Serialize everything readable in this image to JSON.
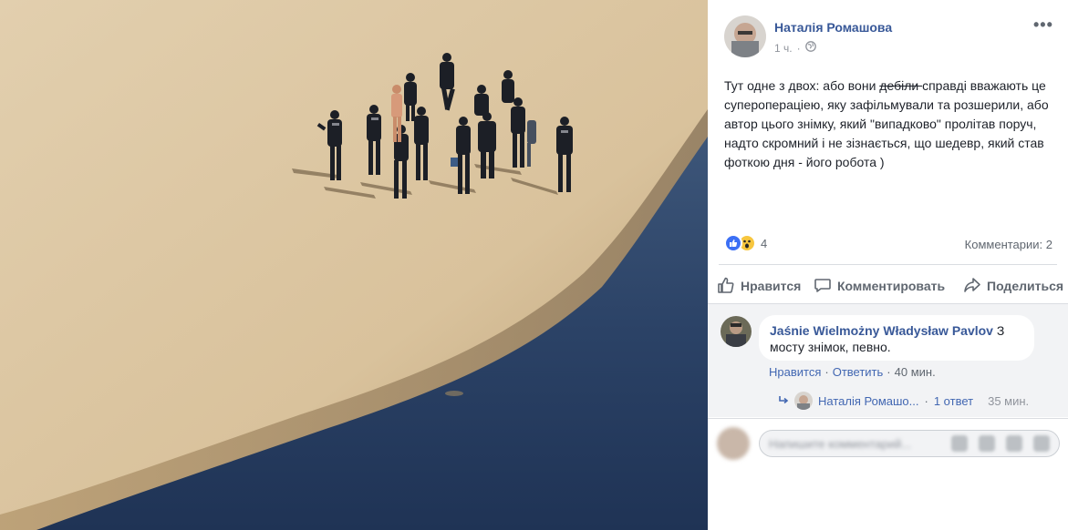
{
  "post": {
    "author": "Наталія Ромашова",
    "time": "1 ч.",
    "privacy_icon": "globe-icon",
    "more_icon": "more-icon",
    "more_label": "•••",
    "text_part1": "Тут одне з двох: або вони ",
    "text_struck": "дебіли ",
    "text_part2": "справді вважають це суперопераціею, яку зафільмували та розшерили, або автор цього знімку, який \"випадково\" пролітав поруч, надто скромний і не зізнається, що шедевр, який став фоткою дня - його робота )"
  },
  "reactions": {
    "icons": [
      "like-icon",
      "wow-icon"
    ],
    "count": "4",
    "comments_label": "Комментарии: 2"
  },
  "actions": {
    "like": "Нравится",
    "comment": "Комментировать",
    "share": "Поделиться"
  },
  "comment": {
    "author": "Jaśnie Wielmożny Władysław Pavlov",
    "text": "З мосту знімок, певно.",
    "like_link": "Нравится",
    "reply_link": "Ответить",
    "time": "40 мин."
  },
  "reply": {
    "author": "Наталія Ромашо...",
    "count": "1 ответ",
    "time": "35 мин."
  },
  "compose": {
    "placeholder": "Напишите комментарий..."
  },
  "colors": {
    "link": "#385898",
    "accent": "#4267b2",
    "sand": "#dcc6a2",
    "water": "#2d4466"
  }
}
